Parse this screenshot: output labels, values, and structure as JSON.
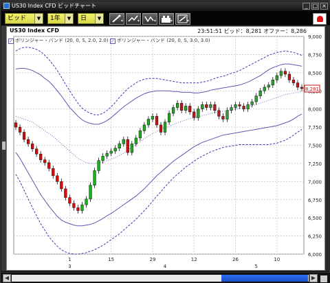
{
  "window": {
    "title": "US30 Index CFD ビッドチャート",
    "buttons": [
      "_",
      "□",
      "×"
    ]
  },
  "toolbar": {
    "price_type": "ビッド",
    "period": "1年",
    "interval": "日",
    "tools": [
      {
        "name": "draw-line-icon"
      },
      {
        "name": "trendline-icon"
      },
      {
        "name": "indicator-icon"
      },
      {
        "name": "chart-type-icon"
      },
      {
        "name": "zoom-icon"
      }
    ],
    "alarm_icon": "bell-alarm-icon"
  },
  "header": {
    "symbol": "US30 Index CFD",
    "quote": "23:51:51  ビッド：8,281  オファー：8,286"
  },
  "legends": [
    {
      "label": "ボリンジャー・バンド (20, 0, S, 2.0, 2.0)"
    },
    {
      "label": "ボリンジャー・バンド (20, 0, S, 3.0, 3.0)"
    }
  ],
  "colors": {
    "up": "#22aa22",
    "down": "#cc1111",
    "band2": "#6a4fb0",
    "band3": "#3b3bb0",
    "mid": "#4a4ab0",
    "current_price": "#cc1111",
    "scroll_thumb": "#2d6ef0"
  },
  "chart_data": {
    "type": "candlestick",
    "y_ticks": [
      "9,000",
      "8,750",
      "8,500",
      "8,250",
      "8,000",
      "7,750",
      "7,500",
      "7,250",
      "7,000",
      "6,750",
      "6,500",
      "6,250",
      "6,000"
    ],
    "ylim": [
      6000,
      9000
    ],
    "current_price_label": "8,281",
    "current_price": 8281,
    "x_day_labels": [
      {
        "label": "1",
        "index": 13
      },
      {
        "label": "15",
        "index": 23
      },
      {
        "label": "29",
        "index": 33
      },
      {
        "label": "12",
        "index": 43
      },
      {
        "label": "26",
        "index": 53
      },
      {
        "label": "10",
        "index": 63
      }
    ],
    "x_month_labels": [
      {
        "label": "3",
        "index": 13
      },
      {
        "label": "4",
        "index": 36
      },
      {
        "label": "5",
        "index": 58
      }
    ],
    "closes": [
      7750,
      7680,
      7580,
      7520,
      7450,
      7380,
      7300,
      7260,
      7180,
      7080,
      7000,
      6900,
      6780,
      6700,
      6640,
      6600,
      6680,
      6760,
      6950,
      7150,
      7290,
      7350,
      7390,
      7420,
      7460,
      7520,
      7580,
      7400,
      7520,
      7600,
      7700,
      7780,
      7860,
      7900,
      7780,
      7680,
      7820,
      7940,
      8020,
      8080,
      7980,
      8040,
      7960,
      7880,
      8000,
      8060,
      8020,
      8060,
      7980,
      7900,
      7860,
      7980,
      8020,
      8060,
      8040,
      8000,
      8060,
      8100,
      8180,
      8250,
      8300,
      8330,
      8400,
      8460,
      8520,
      8480,
      8400,
      8360,
      8300,
      8281
    ],
    "bollinger_2_0": {
      "middle": [
        7900,
        7880,
        7860,
        7840,
        7820,
        7780,
        7740,
        7700,
        7660,
        7620,
        7570,
        7520,
        7470,
        7420,
        7370,
        7320,
        7290,
        7260,
        7250,
        7250,
        7260,
        7270,
        7290,
        7310,
        7330,
        7360,
        7390,
        7430,
        7470,
        7510,
        7550,
        7590,
        7630,
        7660,
        7690,
        7720,
        7740,
        7760,
        7790,
        7810,
        7830,
        7850,
        7870,
        7880,
        7890,
        7910,
        7920,
        7940,
        7950,
        7960,
        7970,
        7980,
        7990,
        8000,
        8010,
        8020,
        8030,
        8050,
        8060,
        8080,
        8100,
        8120,
        8140,
        8160,
        8180,
        8200,
        8210,
        8220,
        8230,
        8240
      ],
      "upper": [
        8550,
        8560,
        8560,
        8550,
        8530,
        8500,
        8470,
        8420,
        8380,
        8320,
        8250,
        8180,
        8100,
        8020,
        7960,
        7900,
        7850,
        7820,
        7800,
        7790,
        7790,
        7810,
        7840,
        7880,
        7930,
        7980,
        8030,
        8070,
        8110,
        8150,
        8180,
        8210,
        8230,
        8240,
        8250,
        8250,
        8250,
        8250,
        8240,
        8240,
        8230,
        8230,
        8230,
        8220,
        8220,
        8230,
        8240,
        8260,
        8270,
        8280,
        8290,
        8300,
        8310,
        8320,
        8330,
        8350,
        8370,
        8400,
        8430,
        8460,
        8500,
        8540,
        8570,
        8590,
        8610,
        8620,
        8620,
        8610,
        8600,
        8590
      ],
      "lower": [
        7400,
        7320,
        7220,
        7120,
        7020,
        6920,
        6820,
        6740,
        6660,
        6590,
        6520,
        6470,
        6440,
        6420,
        6400,
        6390,
        6390,
        6400,
        6410,
        6430,
        6460,
        6490,
        6530,
        6560,
        6600,
        6640,
        6680,
        6720,
        6760,
        6800,
        6850,
        6900,
        6960,
        7020,
        7080,
        7130,
        7180,
        7230,
        7280,
        7320,
        7360,
        7400,
        7440,
        7480,
        7510,
        7540,
        7560,
        7580,
        7600,
        7620,
        7640,
        7650,
        7660,
        7670,
        7680,
        7690,
        7700,
        7710,
        7720,
        7730,
        7740,
        7750,
        7760,
        7770,
        7790,
        7810,
        7830,
        7860,
        7900,
        7930
      ]
    },
    "bollinger_3_0": {
      "upper": [
        8800,
        8830,
        8850,
        8850,
        8840,
        8820,
        8790,
        8740,
        8680,
        8610,
        8530,
        8440,
        8340,
        8250,
        8160,
        8080,
        8010,
        7970,
        7940,
        7920,
        7920,
        7940,
        7980,
        8030,
        8090,
        8160,
        8220,
        8280,
        8320,
        8360,
        8390,
        8410,
        8420,
        8420,
        8420,
        8410,
        8400,
        8390,
        8380,
        8370,
        8360,
        8360,
        8360,
        8360,
        8360,
        8370,
        8380,
        8400,
        8420,
        8440,
        8450,
        8470,
        8490,
        8510,
        8530,
        8560,
        8590,
        8620,
        8650,
        8680,
        8710,
        8740,
        8760,
        8780,
        8790,
        8800,
        8790,
        8780,
        8760,
        8740
      ],
      "lower": [
        7100,
        7000,
        6880,
        6760,
        6640,
        6530,
        6420,
        6330,
        6240,
        6170,
        6110,
        6060,
        6030,
        6010,
        6000,
        6000,
        6010,
        6020,
        6040,
        6060,
        6090,
        6120,
        6160,
        6200,
        6240,
        6280,
        6330,
        6380,
        6430,
        6480,
        6540,
        6600,
        6660,
        6730,
        6800,
        6860,
        6930,
        6990,
        7050,
        7100,
        7150,
        7200,
        7240,
        7280,
        7320,
        7350,
        7380,
        7410,
        7430,
        7450,
        7470,
        7480,
        7490,
        7500,
        7510,
        7510,
        7510,
        7510,
        7510,
        7510,
        7510,
        7510,
        7520,
        7530,
        7550,
        7570,
        7600,
        7640,
        7680,
        7720
      ]
    }
  },
  "scrollbar": {
    "left_arrow": "◀",
    "right_arrow": "▶",
    "position_fraction": 0.75
  }
}
